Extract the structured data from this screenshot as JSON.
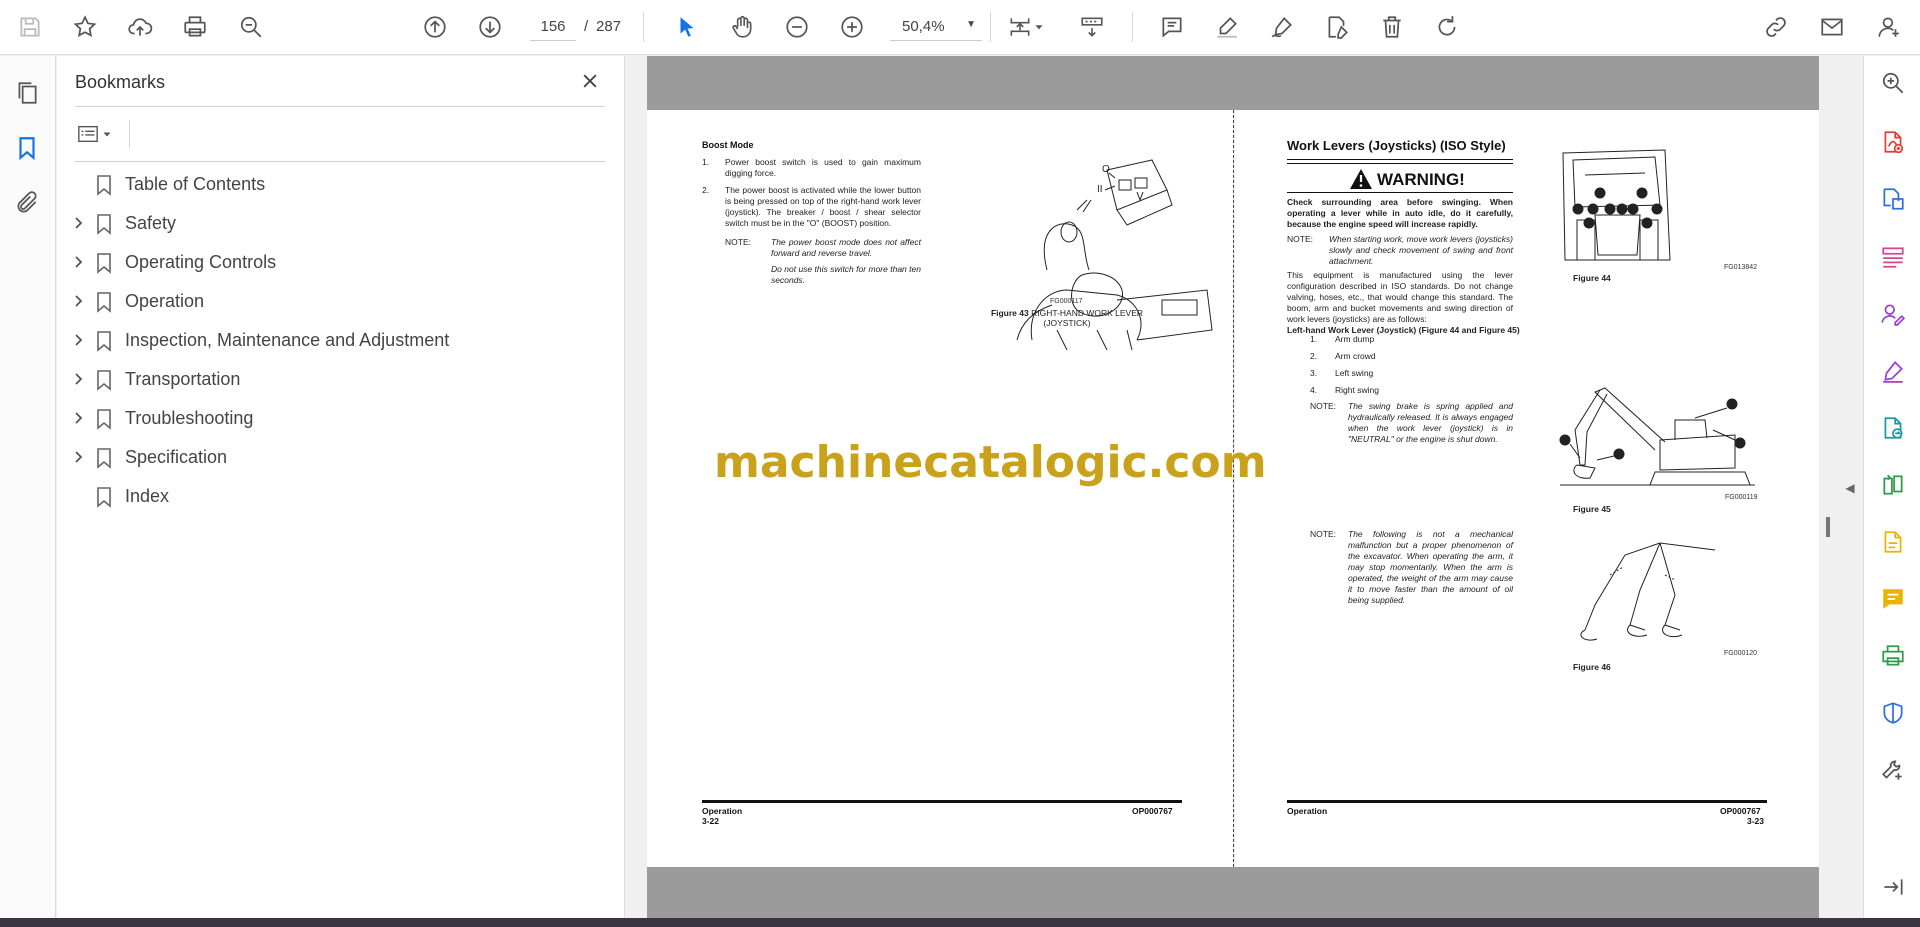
{
  "toolbar": {
    "page_current": "156",
    "page_separator": "/",
    "page_total": "287",
    "zoom": "50,4%"
  },
  "bookmarks": {
    "title": "Bookmarks",
    "items": [
      {
        "label": "Table of Contents",
        "expandable": false
      },
      {
        "label": "Safety",
        "expandable": true
      },
      {
        "label": "Operating Controls",
        "expandable": true
      },
      {
        "label": "Operation",
        "expandable": true
      },
      {
        "label": "Inspection, Maintenance and Adjustment",
        "expandable": true
      },
      {
        "label": "Transportation",
        "expandable": true
      },
      {
        "label": "Troubleshooting",
        "expandable": true
      },
      {
        "label": "Specification",
        "expandable": true
      },
      {
        "label": "Index",
        "expandable": false
      }
    ]
  },
  "left_page": {
    "heading": "Boost Mode",
    "step1_num": "1.",
    "step1": "Power boost switch is used to gain maximum digging force.",
    "step2_num": "2.",
    "step2": "The power boost is activated while the lower button is being pressed on top of the right-hand work lever (joystick). The breaker / boost / shear selector switch must be in the \"O\" (BOOST) position.",
    "note_label": "NOTE:",
    "note1": "The power boost mode does not affect forward and reverse travel.",
    "note2": "Do not use this switch for more than ten seconds.",
    "fig_id": "FG000117",
    "fig_caption_bold": "Figure 43",
    "fig_caption": "RIGHT-HAND WORK LEVER (JOYSTICK)",
    "footer_section": "Operation",
    "footer_page": "3-22",
    "footer_code": "OP000767"
  },
  "watermark": "machinecatalogic.com",
  "right_page": {
    "heading": "Work Levers (Joysticks) (ISO Style)",
    "warning": "WARNING!",
    "warning_text": "Check surrounding area before swinging. When operating a lever while in auto idle, do it carefully, because the engine speed will increase rapidly.",
    "note_label": "NOTE:",
    "note1": "When starting work, move work levers (joysticks) slowly and check movement of swing and front attachment.",
    "para": "This equipment is manufactured using the lever configuration described in ISO standards. Do not change valving, hoses, etc., that would change this standard. The boom, arm and bucket movements and swing direction of work levers (joysticks) are as follows:",
    "subheading": "Left-hand Work Lever (Joystick) (Figure 44 and Figure 45)",
    "list": [
      {
        "num": "1.",
        "text": "Arm dump"
      },
      {
        "num": "2.",
        "text": "Arm crowd"
      },
      {
        "num": "3.",
        "text": "Left swing"
      },
      {
        "num": "4.",
        "text": "Right swing"
      }
    ],
    "note2": "The swing brake is spring applied and hydraulically released. It is always engaged when the work lever (joystick) is in \"NEUTRAL\" or the engine is shut down.",
    "note3": "The following is not a mechanical malfunction but a proper phenomenon of the excavator. When operating the arm, it may stop momentarily. When the arm is operated, the weight of the arm may cause it to move faster than the amount of oil being supplied.",
    "fig44_id": "FG013842",
    "fig44_caption": "Figure 44",
    "fig45_id": "FG000119",
    "fig45_caption": "Figure 45",
    "fig46_id": "FG000120",
    "fig46_caption": "Figure 46",
    "footer_section": "Operation",
    "footer_page": "3-23",
    "footer_code": "OP000767"
  },
  "icons": {
    "toolbar": [
      "save-icon",
      "bookmark-star-icon",
      "upload-icon",
      "print-icon",
      "zoom-search-icon",
      "page-up-icon",
      "page-down-icon",
      "select-cursor-icon",
      "hand-tool-icon",
      "zoom-out-icon",
      "zoom-in-icon",
      "page-fit-icon",
      "scroll-mode-icon",
      "comment-icon",
      "highlight-icon",
      "sign-icon",
      "edit-pdf-icon",
      "delete-icon",
      "rotate-icon",
      "share-link-icon",
      "email-icon",
      "account-icon"
    ],
    "right_rail": [
      "zoom-panel-icon",
      "export-pdf-icon",
      "create-pdf-icon",
      "organize-pages-icon",
      "request-signature-icon",
      "fill-sign-icon",
      "convert-icon",
      "compare-icon",
      "edit-icon",
      "comment-rail-icon",
      "print-production-icon",
      "protect-icon",
      "more-tools-icon",
      "collapse-panel-icon"
    ]
  },
  "colors": {
    "accent": "#1473e6",
    "watermark": "#c9a11a",
    "doc_background": "#9b9b9b"
  }
}
